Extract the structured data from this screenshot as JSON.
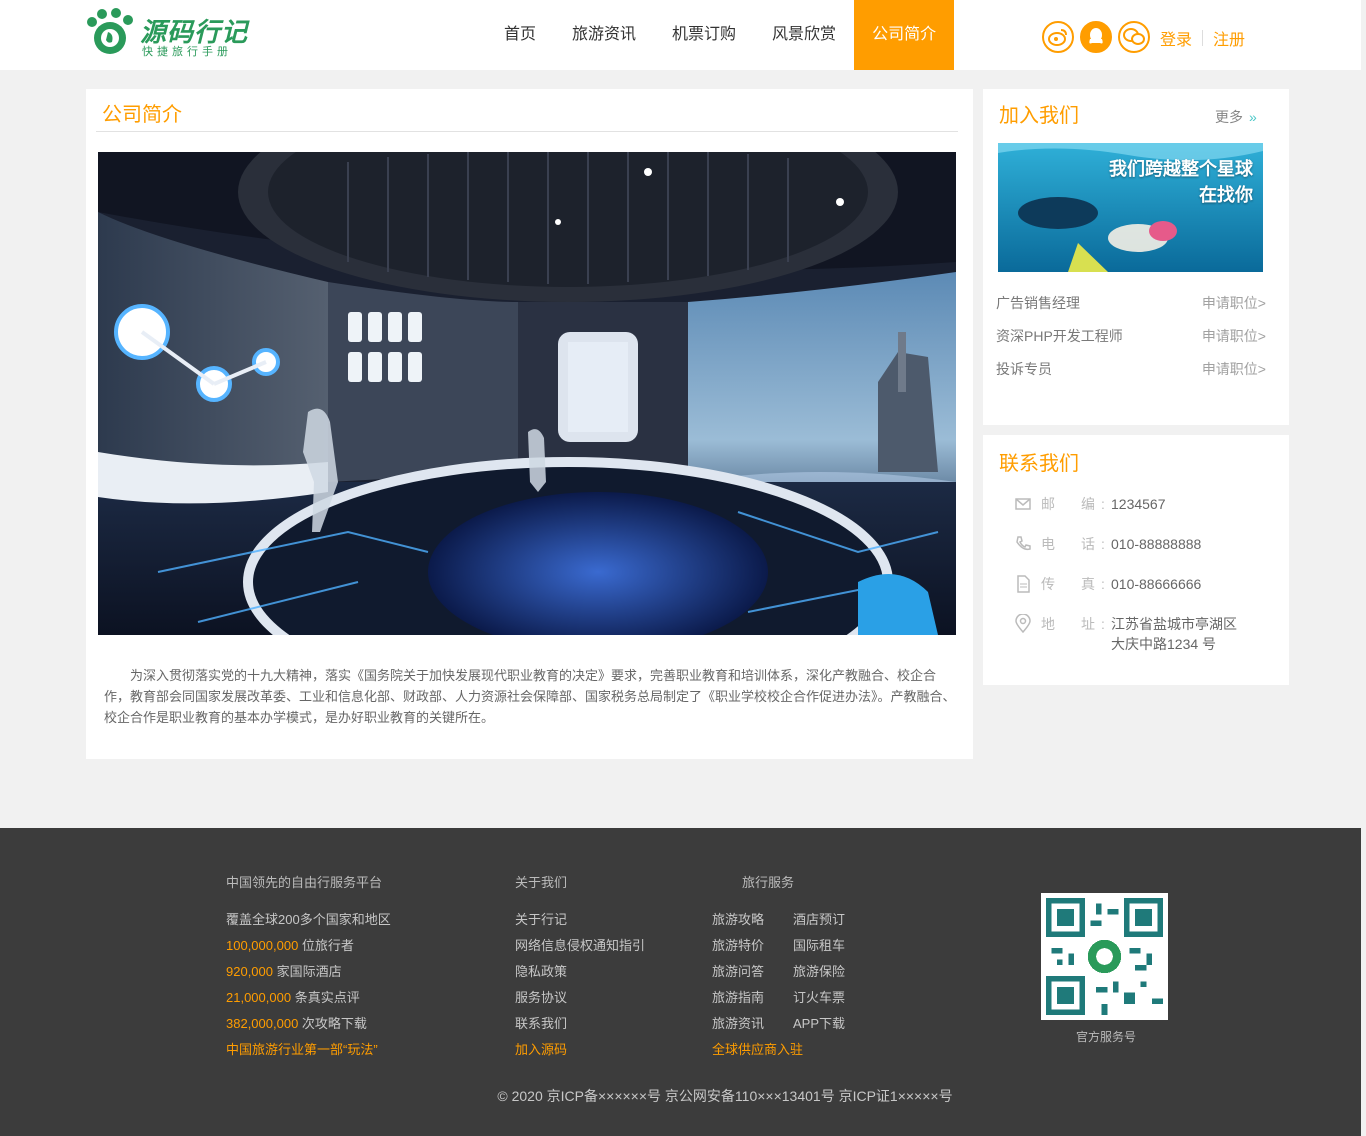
{
  "header": {
    "logo_name": "源码行记",
    "logo_slogan": "快捷旅行手册",
    "nav": [
      "首页",
      "旅游资讯",
      "机票订购",
      "风景欣赏",
      "公司简介"
    ],
    "active_nav": "公司简介",
    "social_icons": [
      "weibo-icon",
      "qq-icon",
      "wechat-icon"
    ],
    "login": "登录",
    "register": "注册"
  },
  "colors": {
    "accent": "#ff9d00",
    "footer_bg": "#3c3c3c",
    "body_bg": "#f1f1f1"
  },
  "about": {
    "title": "公司简介",
    "image_caption": "展馆",
    "text": "为深入贯彻落实党的十九大精神，落实《国务院关于加快发展现代职业教育的决定》要求，完善职业教育和培训体系，深化产教融合、校企合作，教育部会同国家发展改革委、工业和信息化部、财政部、人力资源社会保障部、国家税务总局制定了《职业学校校企合作促进办法》。产教融合、校企合作是职业教育的基本办学模式，是办好职业教育的关键所在。"
  },
  "join": {
    "title": "加入我们",
    "more": "更多",
    "banner_line1": "我们跨越整个星球",
    "banner_line2": "在找你",
    "jobs": [
      {
        "name": "广告销售经理",
        "apply": "申请职位>"
      },
      {
        "name": "资深PHP开发工程师",
        "apply": "申请职位>"
      },
      {
        "name": "投诉专员",
        "apply": "申请职位>"
      }
    ]
  },
  "contact": {
    "title": "联系我们",
    "rows": [
      {
        "icon": "mail-icon",
        "label": "邮　编:",
        "value": "1234567"
      },
      {
        "icon": "phone-icon",
        "label": "电　话:",
        "value": "010-88888888"
      },
      {
        "icon": "fax-icon",
        "label": "传　真:",
        "value": "010-88666666"
      },
      {
        "icon": "location-icon",
        "label": "地　址:",
        "value": "江苏省盐城市亭湖区",
        "value2": "大庆中路1234 号"
      }
    ]
  },
  "footer": {
    "col1": {
      "head": "中国领先的自由行服务平台",
      "line1": "覆盖全球200多个国家和地区",
      "stats": [
        {
          "num": "100,000,000",
          "text": "位旅行者"
        },
        {
          "num": "920,000",
          "text": "家国际酒店"
        },
        {
          "num": "21,000,000",
          "text": "条真实点评"
        },
        {
          "num": "382,000,000",
          "text": "次攻略下载"
        }
      ],
      "slogan": "中国旅游行业第一部“玩法”"
    },
    "col2": {
      "head": "关于我们",
      "links": [
        "关于行记",
        "网络信息侵权通知指引",
        "隐私政策",
        "服务协议",
        "联系我们"
      ],
      "highlight": "加入源码"
    },
    "col3": {
      "head": "旅行服务",
      "left": [
        "旅游攻略",
        "旅游特价",
        "旅游问答",
        "旅游指南",
        "旅游资讯"
      ],
      "right": [
        "酒店预订",
        "国际租车",
        "旅游保险",
        "订火车票",
        "APP下载"
      ],
      "highlight": "全球供应商入驻"
    },
    "qr_caption": "官方服务号",
    "copyright": "© 2020 京ICP备××××××号 京公网安备110×××13401号 京ICP证1×××××号"
  }
}
